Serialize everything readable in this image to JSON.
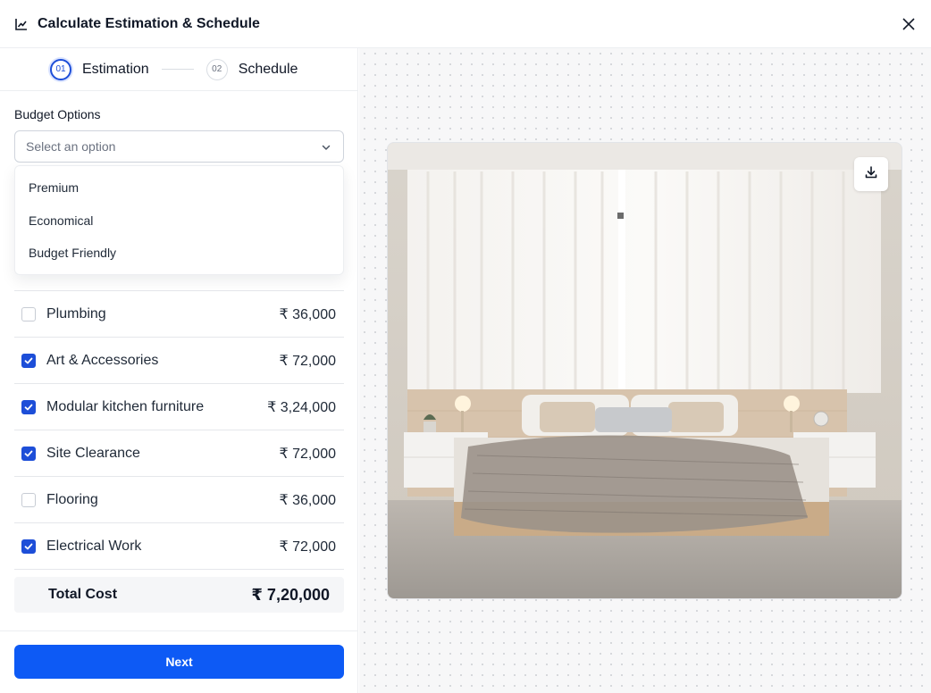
{
  "header": {
    "title": "Calculate Estimation & Schedule",
    "title_icon": "chart-line-icon",
    "close_icon": "close-icon"
  },
  "stepper": {
    "steps": [
      {
        "num": "01",
        "label": "Estimation",
        "state": "active"
      },
      {
        "num": "02",
        "label": "Schedule",
        "state": "inactive"
      }
    ]
  },
  "budget": {
    "label": "Budget Options",
    "placeholder": "Select an option",
    "options": [
      "Premium",
      "Economical",
      "Budget Friendly"
    ]
  },
  "items": [
    {
      "label": "Plumbing",
      "amount": "₹ 36,000",
      "checked": false
    },
    {
      "label": "Art & Accessories",
      "amount": "₹ 72,000",
      "checked": true
    },
    {
      "label": "Modular kitchen furniture",
      "amount": "₹ 3,24,000",
      "checked": true
    },
    {
      "label": "Site Clearance",
      "amount": "₹ 72,000",
      "checked": true
    },
    {
      "label": "Flooring",
      "amount": "₹ 36,000",
      "checked": false
    },
    {
      "label": "Electrical Work",
      "amount": "₹ 72,000",
      "checked": true
    }
  ],
  "total": {
    "label": "Total Cost",
    "amount": "₹ 7,20,000"
  },
  "footer": {
    "next_label": "Next"
  },
  "preview": {
    "download_icon": "download-icon"
  },
  "colors": {
    "accent": "#1d4ed8",
    "primary_button": "#0d5af5"
  }
}
